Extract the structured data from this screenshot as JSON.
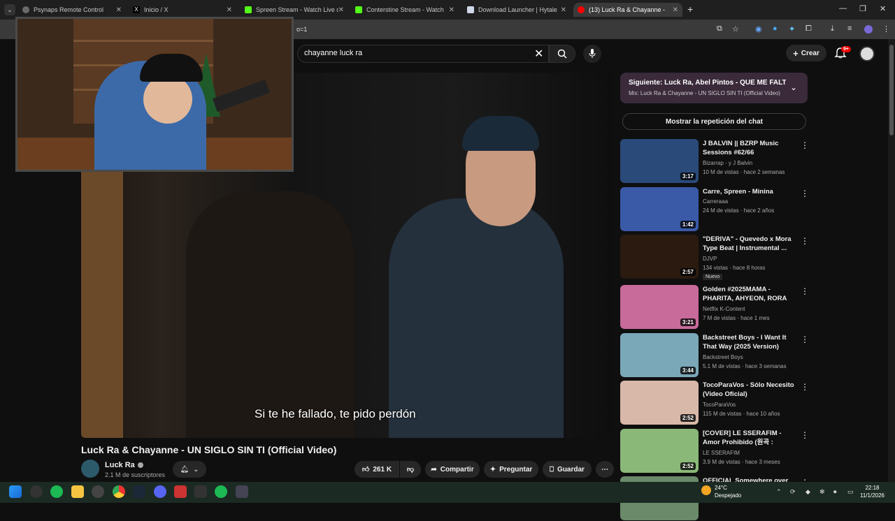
{
  "browser": {
    "tabs": [
      {
        "title": "Psynaps Remote Control"
      },
      {
        "title": "Inicio / X"
      },
      {
        "title": "Spreen Stream - Watch Live on"
      },
      {
        "title": "Conterstine Stream - Watch Liv"
      },
      {
        "title": "Download Launcher | Hytale"
      },
      {
        "title": "(13) Luck Ra & Chayanne - UN"
      }
    ],
    "url_fragment": "o=1"
  },
  "youtube": {
    "search_query": "chayanne luck ra",
    "create_label": "Crear",
    "notifications_badge": "9+",
    "video": {
      "subtitle": "Si te he fallado, te pido perdón",
      "title": "Luck Ra & Chayanne - UN SIGLO SIN TI (Official Video)",
      "channel": "Luck Ra",
      "subscribers": "2.1 M de suscriptores",
      "likes": "261 K",
      "share_label": "Compartir",
      "ask_label": "Preguntar",
      "save_label": "Guardar"
    },
    "next": {
      "title": "Siguiente: Luck Ra, Abel Pintos - QUE ME FALTE TO...",
      "subtitle": "Mix: Luck Ra & Chayanne - UN SIGLO SIN TI (Official Video)"
    },
    "chat_replay_label": "Mostrar la repetición del chat",
    "recommendations": [
      {
        "title": "J BALVIN || BZRP Music Sessions #62/66",
        "channel": "Bizarrap · y J Balvin",
        "meta": "10 M de vistas · hace 2 semanas",
        "duration": "3:17",
        "color": "#2a4a7a"
      },
      {
        "title": "Carre, Spreen - Minina",
        "channel": "Carreraaa",
        "meta": "24 M de vistas · hace 2 años",
        "duration": "1:42",
        "color": "#3a5aa8"
      },
      {
        "title": "\"DERIVA\" - Quevedo x Mora Type Beat | Instrumental ...",
        "channel": "DJVP",
        "meta": "134 vistas · hace 8 horas",
        "duration": "2:57",
        "badge": "Nuevo",
        "color": "#2a1a10"
      },
      {
        "title": "Golden #2025MAMA - PHARITA, AHYEON, RORA fro...",
        "channel": "Netflix K-Content",
        "meta": "7 M de vistas · hace 1 mes",
        "duration": "3:21",
        "color": "#c86a9a"
      },
      {
        "title": "Backstreet Boys - I Want It That Way (2025 Version)",
        "channel": "Backstreet Boys",
        "meta": "5.1 M de vistas · hace 3 semanas",
        "duration": "3:44",
        "color": "#7aa8b8"
      },
      {
        "title": "TocoParaVos - Sólo Necesito (Video Oficial)",
        "channel": "TocoParaVos",
        "meta": "115 M de vistas · hace 10 años",
        "duration": "2:52",
        "color": "#d8b8a8"
      },
      {
        "title": "[COVER] LE SSERAFIM - Amor Prohibido (원곡 : Selena)",
        "channel": "LE SSERAFIM",
        "meta": "3.9 M de vistas · hace 3 meses",
        "duration": "2:52",
        "color": "#8ab878"
      },
      {
        "title": "OFFICIAL Somewhere over the",
        "channel": "",
        "meta": "",
        "duration": "",
        "color": "#6a8a6a"
      }
    ]
  },
  "taskbar": {
    "weather_temp": "24°C",
    "weather_desc": "Despejado",
    "time": "22:18",
    "date": "11/1/2026"
  }
}
